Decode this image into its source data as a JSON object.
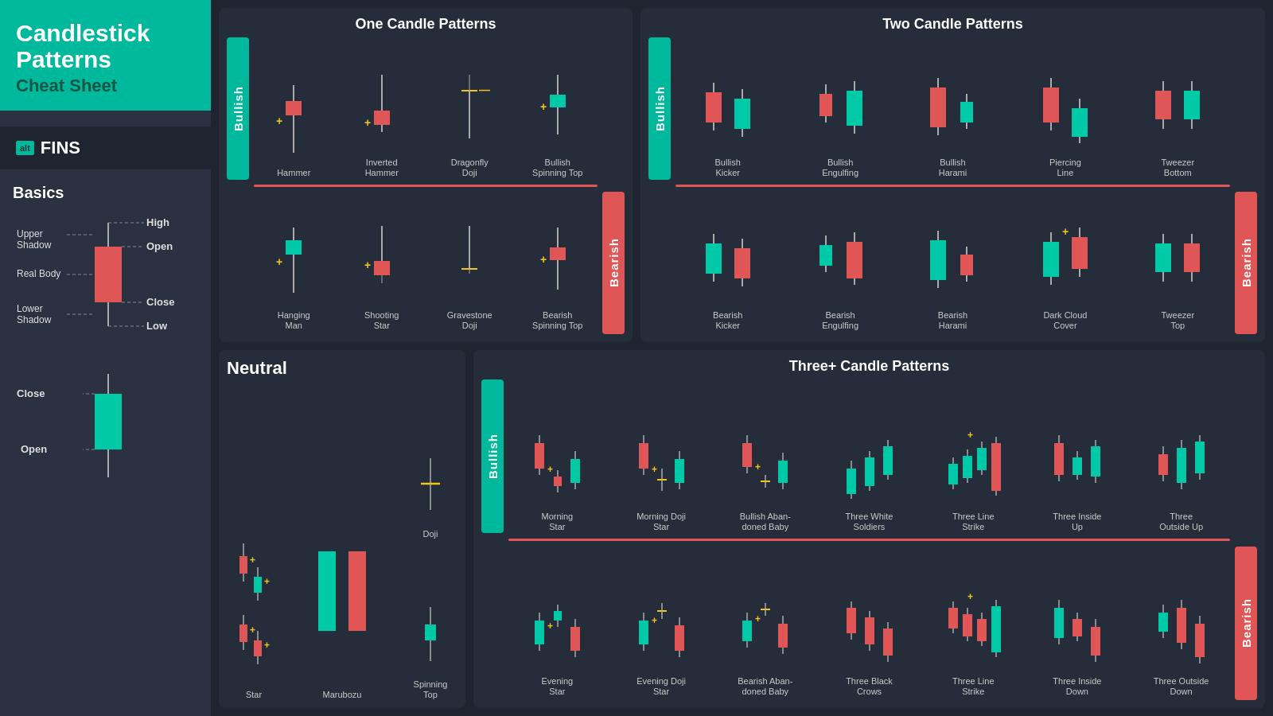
{
  "sidebar": {
    "title": "Candlestick\nPatterns",
    "subtitle": "Cheat Sheet",
    "logo_alt": "alt",
    "logo_fins": "FINS",
    "basics_title": "Basics",
    "labels": {
      "high": "High",
      "open_upper": "Open",
      "close_upper": "Close",
      "low": "Low",
      "close_lower": "Close",
      "open_lower": "Open",
      "upper_shadow": "Upper\nShadow",
      "real_body": "Real Body",
      "lower_shadow": "Lower\nShadow"
    }
  },
  "one_candle": {
    "title": "One Candle Patterns",
    "bullish_label": "Bullish",
    "bearish_label": "Bearish",
    "bullish_patterns": [
      "Hammer",
      "Inverted\nHammer",
      "Dragonfly\nDoji",
      "Bullish\nSpinning Top"
    ],
    "bearish_patterns": [
      "Hanging\nMan",
      "Shooting\nStar",
      "Gravestone\nDoji",
      "Bearish\nSpinning Top"
    ]
  },
  "two_candle": {
    "title": "Two Candle Patterns",
    "bullish_label": "Bullish",
    "bearish_label": "Bearish",
    "bullish_patterns": [
      "Bullish\nKicker",
      "Bullish\nEngulfing",
      "Bullish\nHarami",
      "Piercing\nLine",
      "Tweezer\nBottom"
    ],
    "bearish_patterns": [
      "Bearish\nKicker",
      "Bearish\nEngulfing",
      "Bearish\nHarami",
      "Dark Cloud\nCover",
      "Tweezer\nTop"
    ]
  },
  "neutral": {
    "title": "Neutral",
    "patterns": [
      "Star",
      "Marubozu",
      "Doji",
      "Spinning\nTop"
    ]
  },
  "three_candle": {
    "title": "Three+ Candle Patterns",
    "bullish_label": "Bullish",
    "bearish_label": "Bearish",
    "bullish_patterns": [
      "Morning\nStar",
      "Morning Doji\nStar",
      "Bullish Aban-\ndoned Baby",
      "Three White\nSoldiers",
      "Three Line\nStrike",
      "Three Inside\nUp",
      "Three\nOutside Up"
    ],
    "bearish_patterns": [
      "Evening\nStar",
      "Evening Doji\nStar",
      "Bearish Aban-\ndoned Baby",
      "Three Black\nCrows",
      "Three Line\nStrike",
      "Three Inside\nDown",
      "Three Outside\nDown"
    ]
  },
  "colors": {
    "bullish_candle": "#00c9a7",
    "bearish_candle": "#e05555",
    "accent_teal": "#00b89c",
    "bg_dark": "#1e2530",
    "panel_bg": "#252d3a",
    "sidebar_bg": "#2a3140",
    "yellow": "#f5c518",
    "wick": "#aaaaaa"
  }
}
